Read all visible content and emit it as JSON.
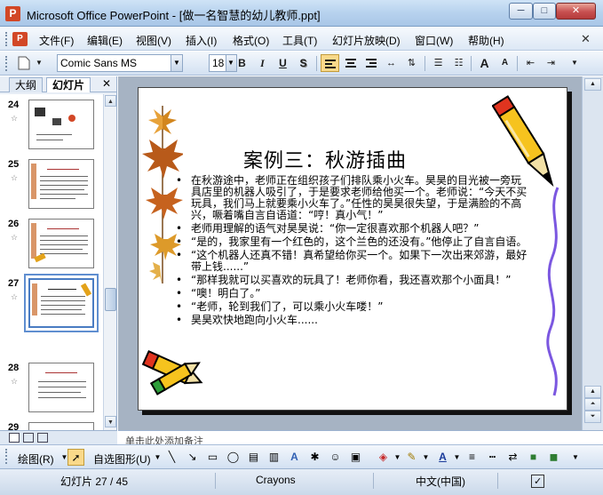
{
  "window": {
    "title": "Microsoft Office PowerPoint - [做一名智慧的幼儿教师.ppt]",
    "min_label": "─",
    "max_label": "□",
    "close_label": "✕"
  },
  "menu": {
    "items": [
      "文件(F)",
      "编辑(E)",
      "视图(V)",
      "插入(I)",
      "格式(O)",
      "工具(T)",
      "幻灯片放映(D)",
      "窗口(W)",
      "帮助(H)"
    ],
    "close_label": "✕"
  },
  "toolbar": {
    "font_name": "Comic Sans MS",
    "font_size": "18",
    "bold": "B",
    "italic": "I",
    "underline": "U",
    "shadow": "S",
    "grow_font": "A",
    "shrink_font": "A"
  },
  "left_panel": {
    "tab_outline": "大纲",
    "tab_slides": "幻灯片",
    "close_label": "✕",
    "slides": [
      {
        "number": "24",
        "selected": false
      },
      {
        "number": "25",
        "selected": false
      },
      {
        "number": "26",
        "selected": false
      },
      {
        "number": "27",
        "selected": true
      },
      {
        "number": "28",
        "selected": false
      },
      {
        "number": "29",
        "selected": false
      }
    ]
  },
  "slide": {
    "title": "案例三：秋游插曲",
    "bullets": [
      "在秋游途中，老师正在组织孩子们排队乘小火车。昊昊的目光被一旁玩具店里的机器人吸引了，于是要求老师给他买一个。老师说：“今天不买玩具，我们马上就要乘小火车了。”任性的昊昊很失望，于是满脸的不高兴，噘着嘴自言自语道：“哼！真小气！”",
      "老师用理解的语气对昊昊说：“你一定很喜欢那个机器人吧？”",
      "“是的，我家里有一个红色的，这个兰色的还没有。”他停止了自言自语。",
      "“这个机器人还真不错！真希望给你买一个。如果下一次出来郊游，最好带上钱......”",
      "“那样我就可以买喜欢的玩具了！老师你看，我还喜欢那个小面具！”",
      "“噢！明白了。”",
      "“老师，轮到我们了，可以乘小火车喽！”",
      "昊昊欢快地跑向小火车......"
    ]
  },
  "notes": {
    "text": "单击此处添加备注"
  },
  "draw_toolbar": {
    "draw_label": "绘图(R)",
    "autoshape_label": "自选图形(U)"
  },
  "status": {
    "slide_info": "幻灯片 27 / 45",
    "template": "Crayons",
    "language": "中文(中国)"
  }
}
